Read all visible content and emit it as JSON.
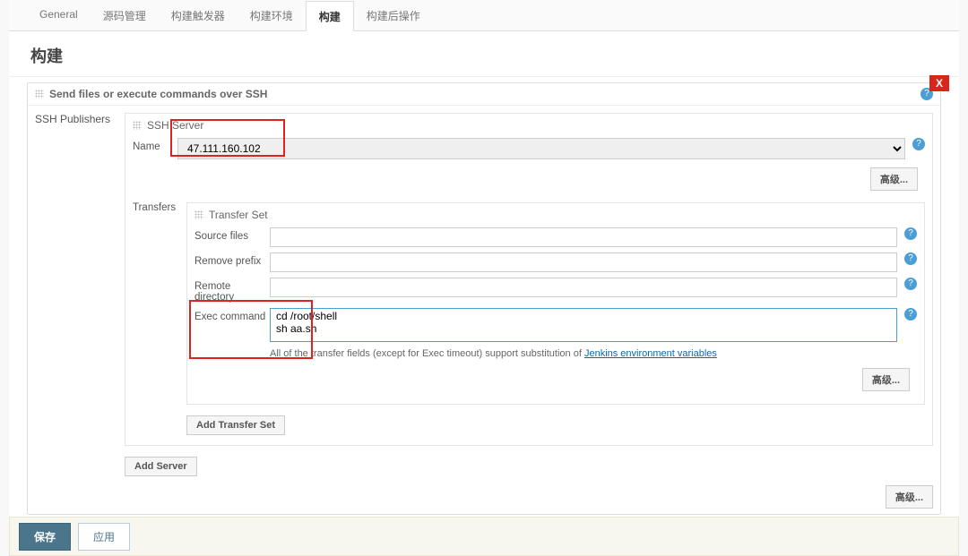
{
  "tabs": {
    "items": [
      "General",
      "源码管理",
      "构建触发器",
      "构建环境",
      "构建",
      "构建后操作"
    ],
    "active_index": 4
  },
  "section_title": "构建",
  "card": {
    "title": "Send files or execute commands over SSH",
    "close_label": "X",
    "publishers_label": "SSH Publishers",
    "ssh_server": {
      "title": "SSH Server",
      "name_label": "Name",
      "name_value": "47.111.160.102",
      "advanced_btn": "高级..."
    },
    "transfers_label": "Transfers",
    "transfer_set": {
      "title": "Transfer Set",
      "source_label": "Source files",
      "source_value": "",
      "remove_prefix_label": "Remove prefix",
      "remove_prefix_value": "",
      "remote_dir_label": "Remote directory",
      "remote_dir_value": "",
      "exec_label": "Exec command",
      "exec_value": "cd /root/shell\nsh aa.sh",
      "note_prefix": "All of the transfer fields (except for Exec timeout) support substitution of ",
      "note_link": "Jenkins environment variables",
      "advanced_btn": "高级..."
    },
    "add_transfer_btn": "Add Transfer Set",
    "add_server_btn": "Add Server",
    "bottom_advanced_btn": "高级..."
  },
  "footer": {
    "save": "保存",
    "apply": "应用"
  }
}
